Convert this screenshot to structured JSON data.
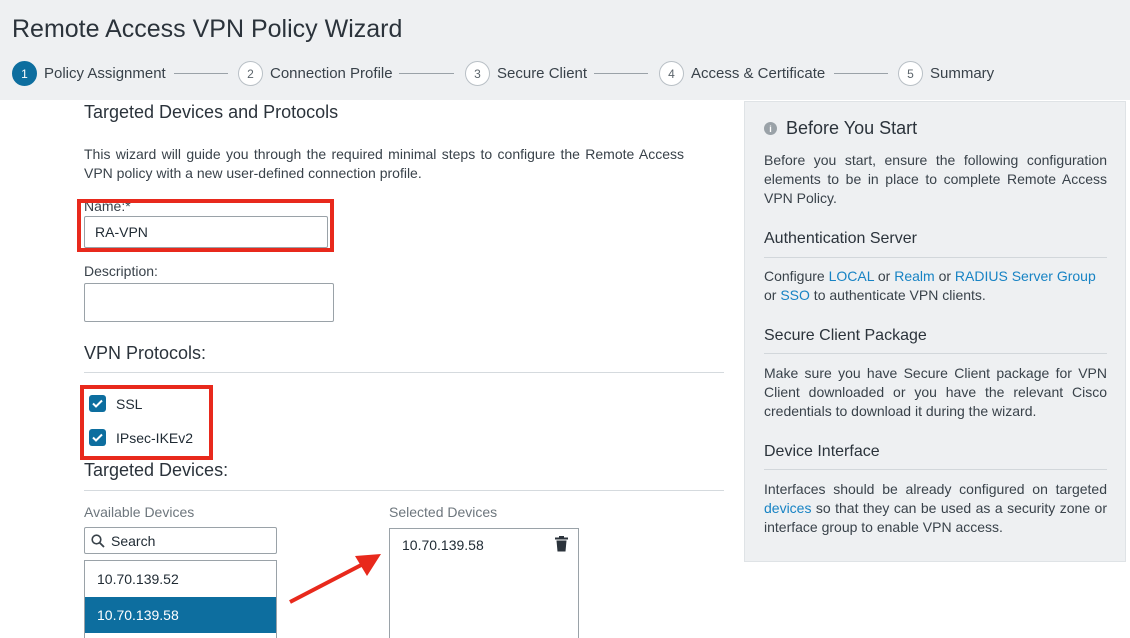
{
  "wizard": {
    "title": "Remote Access VPN Policy Wizard",
    "steps": [
      {
        "num": "1",
        "label": "Policy Assignment"
      },
      {
        "num": "2",
        "label": "Connection Profile"
      },
      {
        "num": "3",
        "label": "Secure Client"
      },
      {
        "num": "4",
        "label": "Access & Certificate"
      },
      {
        "num": "5",
        "label": "Summary"
      }
    ]
  },
  "form": {
    "section_title": "Targeted Devices and Protocols",
    "intro": "This wizard will guide you through the required minimal steps to configure the Remote Access VPN policy with a new user-defined connection profile.",
    "name_label": "Name:*",
    "name_value": "RA-VPN",
    "description_label": "Description:",
    "description_value": "",
    "protocols_title": "VPN Protocols:",
    "protocols": [
      {
        "label": "SSL",
        "checked": true
      },
      {
        "label": "IPsec-IKEv2",
        "checked": true
      }
    ],
    "devices_title": "Targeted Devices:",
    "available_title": "Available Devices",
    "search_placeholder": "Search",
    "available_devices": [
      "10.70.139.52",
      "10.70.139.58"
    ],
    "selected_title": "Selected Devices",
    "selected_devices": [
      "10.70.139.58"
    ]
  },
  "info_panel": {
    "heading": "Before You Start",
    "intro": "Before you start, ensure the following configuration elements to be in place to complete Remote Access VPN Policy.",
    "auth": {
      "title": "Authentication Server",
      "text_configure": "Configure ",
      "link_local": "LOCAL",
      "text_or1": " or ",
      "link_realm": "Realm",
      "text_or2": " or ",
      "link_radius": "RADIUS Server Group",
      "text_or3": " or ",
      "link_sso": "SSO",
      "text_end": " to authenticate VPN clients."
    },
    "client": {
      "title": "Secure Client Package",
      "text": "Make sure you have Secure Client package for VPN Client downloaded or you have the relevant Cisco credentials to download it during the wizard."
    },
    "iface": {
      "title": "Device Interface",
      "text_start": "Interfaces should be already configured on targeted ",
      "link_devices": "devices",
      "text_end": " so that they can be used as a security zone or interface group to enable VPN access."
    }
  },
  "colors": {
    "accent": "#0d6e9f",
    "highlight": "#e8291c",
    "link": "#1783c4"
  }
}
